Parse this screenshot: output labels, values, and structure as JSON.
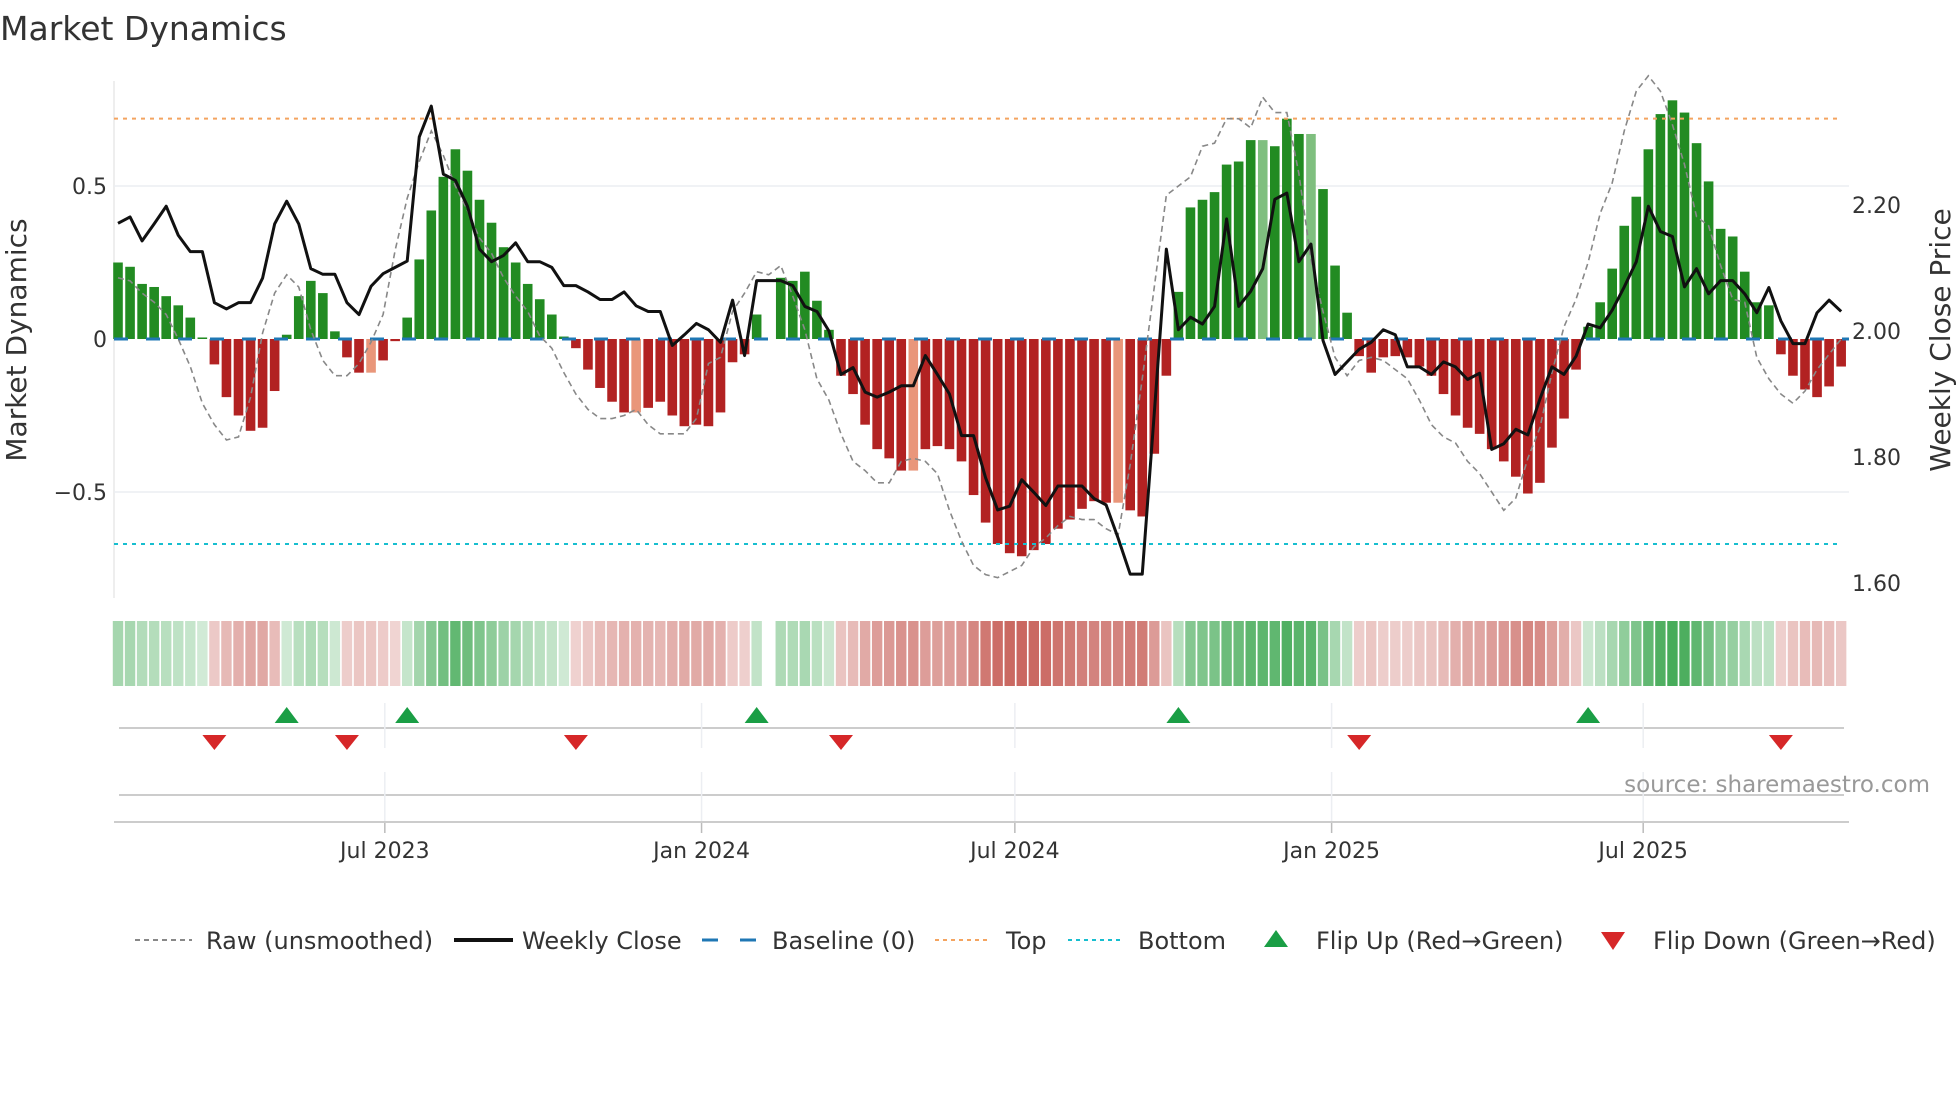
{
  "title": "Market Dynamics",
  "source": "source: sharemaestro.com",
  "colors": {
    "strong_green": "#228b22",
    "weak_green": "#7fbf7f",
    "strong_red": "#b22222",
    "weak_red": "#e9967a",
    "raw": "#888888",
    "close": "#111111",
    "baseline": "#1f77b4",
    "top": "#f4a460",
    "bottom": "#17becf",
    "flip_up": "#1a9e45",
    "flip_down": "#d62728"
  },
  "chart_data": {
    "type": "bar",
    "title": "Market Dynamics",
    "ylabel": "Market Dynamics",
    "y2label": "Weekly Close Price",
    "x_start": "2023-01-27",
    "frequency": "weekly",
    "ylim": [
      -0.68,
      0.88
    ],
    "y2lim": [
      1.6,
      2.4
    ],
    "yticks": [
      {
        "v": 0.5,
        "label": "0.5"
      },
      {
        "v": 0,
        "label": "0"
      },
      {
        "v": -0.5,
        "label": "−0.5"
      }
    ],
    "y2ticks": [
      {
        "v": 2.2,
        "label": "2.20"
      },
      {
        "v": 2.0,
        "label": "2.00"
      },
      {
        "v": 1.8,
        "label": "1.80"
      },
      {
        "v": 1.6,
        "label": "1.60"
      }
    ],
    "xticks": [
      {
        "date": "2023-07-01",
        "label": "Jul 2023"
      },
      {
        "date": "2024-01-01",
        "label": "Jan 2024"
      },
      {
        "date": "2024-07-01",
        "label": "Jul 2024"
      },
      {
        "date": "2025-01-01",
        "label": "Jan 2025"
      },
      {
        "date": "2025-07-01",
        "label": "Jul 2025"
      }
    ],
    "top_level": 0.72,
    "bottom_level": -0.67,
    "baseline": 0,
    "smoothed": [
      0.25,
      0.236,
      0.18,
      0.17,
      0.14,
      0.11,
      0.07,
      0.005,
      -0.083,
      -0.19,
      -0.25,
      -0.3,
      -0.29,
      -0.17,
      0.014,
      0.14,
      0.19,
      0.15,
      0.025,
      -0.06,
      -0.11,
      -0.11,
      -0.07,
      -0.007,
      0.07,
      0.26,
      0.42,
      0.53,
      0.62,
      0.55,
      0.455,
      0.38,
      0.3,
      0.25,
      0.18,
      0.13,
      0.08,
      0.008,
      -0.03,
      -0.1,
      -0.16,
      -0.205,
      -0.24,
      -0.24,
      -0.225,
      -0.205,
      -0.25,
      -0.285,
      -0.28,
      -0.285,
      -0.24,
      -0.076,
      -0.05,
      0.08,
      null,
      0.2,
      0.19,
      0.22,
      0.125,
      0.03,
      -0.12,
      -0.18,
      -0.28,
      -0.36,
      -0.39,
      -0.43,
      -0.43,
      -0.36,
      -0.35,
      -0.36,
      -0.4,
      -0.51,
      -0.6,
      -0.67,
      -0.7,
      -0.71,
      -0.69,
      -0.67,
      -0.62,
      -0.59,
      -0.555,
      -0.53,
      -0.535,
      -0.535,
      -0.56,
      -0.58,
      -0.375,
      -0.12,
      0.154,
      0.43,
      0.455,
      0.48,
      0.57,
      0.58,
      0.65,
      0.65,
      0.63,
      0.72,
      0.67,
      0.67,
      0.49,
      0.24,
      0.086,
      -0.056,
      -0.11,
      -0.06,
      -0.056,
      -0.06,
      -0.09,
      -0.12,
      -0.18,
      -0.25,
      -0.29,
      -0.31,
      -0.36,
      -0.4,
      -0.45,
      -0.505,
      -0.47,
      -0.355,
      -0.26,
      -0.1,
      0.04,
      0.12,
      0.23,
      0.37,
      0.465,
      0.62,
      0.735,
      0.78,
      0.74,
      0.64,
      0.515,
      0.36,
      0.335,
      0.22,
      0.12,
      0.11,
      -0.05,
      -0.12,
      -0.165,
      -0.19,
      -0.155,
      -0.09
    ],
    "raw": [
      0.2,
      0.19,
      0.15,
      0.12,
      0.08,
      0.0,
      -0.09,
      -0.21,
      -0.28,
      -0.33,
      -0.32,
      -0.19,
      0.02,
      0.15,
      0.21,
      0.17,
      0.03,
      -0.07,
      -0.12,
      -0.12,
      -0.08,
      -0.01,
      0.08,
      0.29,
      0.46,
      0.58,
      0.68,
      0.6,
      0.5,
      0.42,
      0.33,
      0.28,
      0.2,
      0.14,
      0.09,
      0.01,
      -0.03,
      -0.11,
      -0.18,
      -0.23,
      -0.26,
      -0.26,
      -0.25,
      -0.23,
      -0.28,
      -0.31,
      -0.31,
      -0.31,
      -0.26,
      -0.08,
      -0.06,
      0.09,
      0.15,
      0.22,
      0.21,
      0.24,
      0.14,
      0.03,
      -0.13,
      -0.2,
      -0.31,
      -0.4,
      -0.43,
      -0.47,
      -0.47,
      -0.4,
      -0.39,
      -0.4,
      -0.44,
      -0.56,
      -0.66,
      -0.74,
      -0.77,
      -0.78,
      -0.76,
      -0.74,
      -0.68,
      -0.65,
      -0.61,
      -0.58,
      -0.59,
      -0.59,
      -0.62,
      -0.64,
      -0.41,
      -0.13,
      0.17,
      0.47,
      0.5,
      0.53,
      0.63,
      0.64,
      0.72,
      0.72,
      0.69,
      0.79,
      0.74,
      0.74,
      0.54,
      0.26,
      0.09,
      -0.06,
      -0.12,
      -0.07,
      -0.06,
      -0.07,
      -0.1,
      -0.13,
      -0.2,
      -0.28,
      -0.32,
      -0.34,
      -0.4,
      -0.44,
      -0.5,
      -0.56,
      -0.52,
      -0.39,
      -0.29,
      -0.11,
      0.04,
      0.13,
      0.25,
      0.41,
      0.51,
      0.68,
      0.81,
      0.86,
      0.81,
      0.7,
      0.57,
      0.4,
      0.37,
      0.24,
      0.13,
      0.12,
      -0.06,
      -0.13,
      -0.18,
      -0.21,
      -0.17,
      -0.1,
      -0.05,
      0.0
    ],
    "weekly_close": [
      2.171,
      2.181,
      2.143,
      2.17,
      2.198,
      2.152,
      2.126,
      2.126,
      2.045,
      2.035,
      2.045,
      2.045,
      2.084,
      2.17,
      2.206,
      2.17,
      2.099,
      2.09,
      2.09,
      2.045,
      2.026,
      2.071,
      2.091,
      2.101,
      2.111,
      2.308,
      2.357,
      2.249,
      2.239,
      2.198,
      2.13,
      2.11,
      2.12,
      2.14,
      2.11,
      2.11,
      2.101,
      2.072,
      2.072,
      2.062,
      2.05,
      2.05,
      2.062,
      2.04,
      2.031,
      2.031,
      1.977,
      1.994,
      2.012,
      2.002,
      1.982,
      2.049,
      1.961,
      2.08,
      2.08,
      2.08,
      2.072,
      2.039,
      2.031,
      2.0,
      1.931,
      1.942,
      1.903,
      1.895,
      1.903,
      1.913,
      1.913,
      1.961,
      1.931,
      1.9,
      1.834,
      1.834,
      1.767,
      1.716,
      1.722,
      1.764,
      1.744,
      1.723,
      1.754,
      1.754,
      1.754,
      1.734,
      1.724,
      1.671,
      1.614,
      1.614,
      1.87,
      2.13,
      2.002,
      2.022,
      2.011,
      2.039,
      2.178,
      2.039,
      2.063,
      2.099,
      2.209,
      2.219,
      2.11,
      2.138,
      1.985,
      1.931,
      1.951,
      1.971,
      1.982,
      2.002,
      1.994,
      1.943,
      1.943,
      1.931,
      1.951,
      1.943,
      1.923,
      1.933,
      1.812,
      1.821,
      1.844,
      1.835,
      1.892,
      1.943,
      1.931,
      1.96,
      2.011,
      2.005,
      2.033,
      2.07,
      2.11,
      2.198,
      2.158,
      2.15,
      2.07,
      2.099,
      2.059,
      2.08,
      2.08,
      2.059,
      2.029,
      2.069,
      2.016,
      1.98,
      1.98,
      2.029,
      2.049,
      2.031
    ],
    "flip_up_weeks": [
      15,
      25,
      54,
      89,
      123
    ],
    "flip_down_weeks": [
      9,
      20,
      39,
      61,
      104,
      139
    ],
    "legend": {
      "placement": "bottom",
      "items": [
        {
          "key": "raw",
          "label": "Raw (unsmoothed)"
        },
        {
          "key": "close",
          "label": "Weekly Close"
        },
        {
          "key": "baseline",
          "label": "Baseline (0)"
        },
        {
          "key": "top",
          "label": "Top"
        },
        {
          "key": "bottom",
          "label": "Bottom"
        },
        {
          "key": "flip_up",
          "label": "Flip Up (Red→Green)"
        },
        {
          "key": "flip_down",
          "label": "Flip Down (Green→Red)"
        }
      ]
    }
  }
}
